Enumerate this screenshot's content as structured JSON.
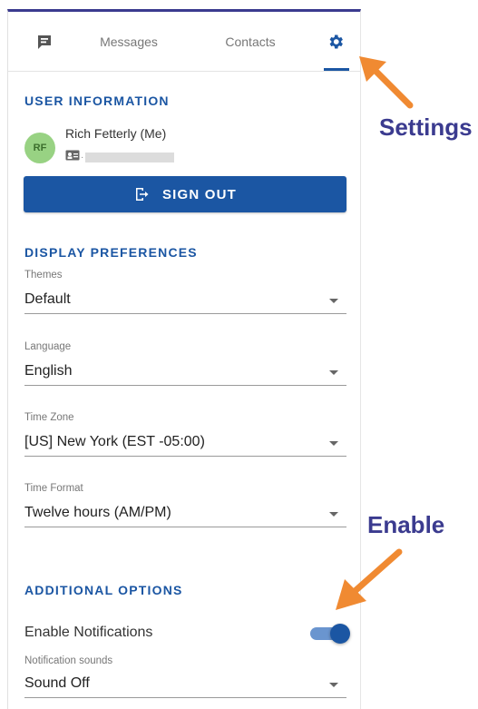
{
  "tabs": {
    "chat_icon": "chat-icon",
    "messages": "Messages",
    "contacts": "Contacts",
    "settings_icon": "gear-icon",
    "active": "settings"
  },
  "user_info": {
    "heading": "USER INFORMATION",
    "initials": "RF",
    "name": "Rich Fetterly (Me)",
    "id_prefix": "·",
    "sign_out_label": "SIGN OUT"
  },
  "display_preferences": {
    "heading": "DISPLAY PREFERENCES",
    "themes": {
      "label": "Themes",
      "value": "Default"
    },
    "language": {
      "label": "Language",
      "value": "English"
    },
    "time_zone": {
      "label": "Time Zone",
      "value": "[US] New York (EST -05:00)"
    },
    "time_format": {
      "label": "Time Format",
      "value": "Twelve hours (AM/PM)"
    }
  },
  "additional_options": {
    "heading": "ADDITIONAL OPTIONS",
    "enable_notifications": {
      "label": "Enable Notifications",
      "on": true
    },
    "notification_sounds": {
      "label": "Notification sounds",
      "value": "Sound Off"
    }
  },
  "annotations": {
    "settings": "Settings",
    "enable": "Enable"
  },
  "colors": {
    "accent": "#1b56a3",
    "annotation_text": "#3b3b8f",
    "annotation_arrow": "#f08a32",
    "avatar": "#98d283"
  }
}
